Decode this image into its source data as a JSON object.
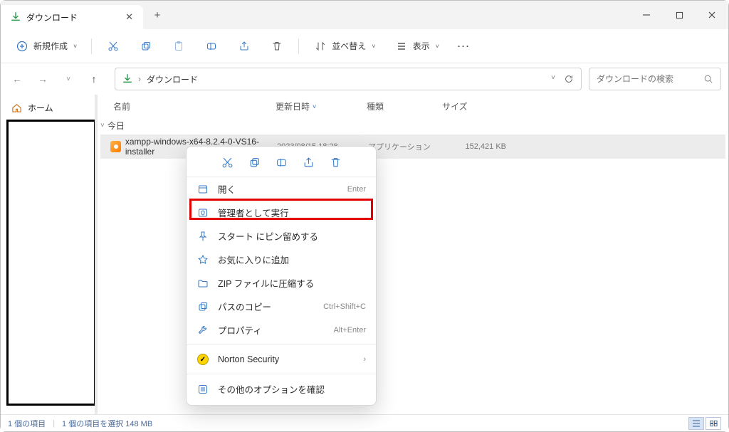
{
  "window": {
    "tab_title": "ダウンロード",
    "minimize": "—",
    "maximize": "▢",
    "close": "✕"
  },
  "toolbar": {
    "new_label": "新規作成",
    "sort_label": "並べ替え",
    "view_label": "表示"
  },
  "address": {
    "breadcrumb_root": "ダウンロード",
    "search_placeholder": "ダウンロードの検索"
  },
  "sidebar": {
    "home_label": "ホーム"
  },
  "columns": {
    "name": "名前",
    "date": "更新日時",
    "type": "種類",
    "size": "サイズ"
  },
  "group": {
    "today": "今日"
  },
  "file": {
    "name": "xampp-windows-x64-8.2.4-0-VS16-installer",
    "date": "2023/08/15 18:28",
    "type": "アプリケーション",
    "size": "152,421 KB"
  },
  "ctx": {
    "open": "開く",
    "open_sc": "Enter",
    "admin": "管理者として実行",
    "pin_start": "スタート にピン留めする",
    "fav": "お気に入りに追加",
    "zip": "ZIP ファイルに圧縮する",
    "copy_path": "パスのコピー",
    "copy_path_sc": "Ctrl+Shift+C",
    "props": "プロパティ",
    "props_sc": "Alt+Enter",
    "norton": "Norton Security",
    "more": "その他のオプションを確認"
  },
  "status": {
    "count": "1 個の項目",
    "sel": "1 個の項目を選択 148 MB"
  }
}
